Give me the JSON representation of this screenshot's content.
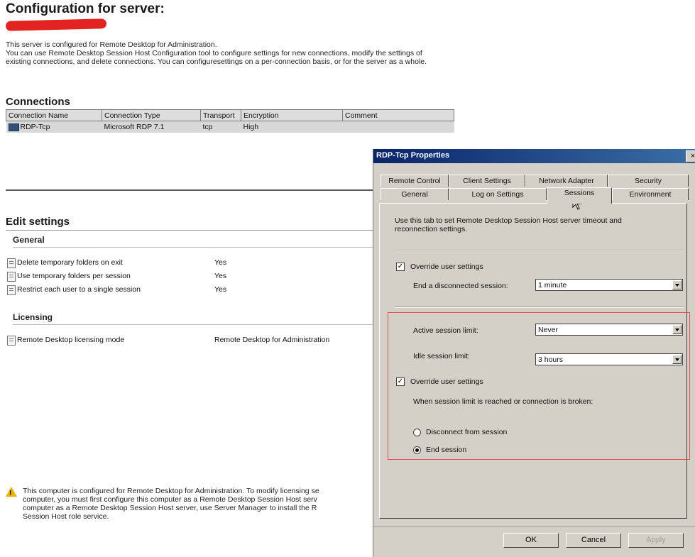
{
  "page": {
    "title": "Configuration for server:",
    "intro": [
      "This server is configured for Remote Desktop for Administration.",
      "You can use Remote Desktop Session Host Configuration tool to configure settings for new connections, modify the settings of",
      "existing connections, and delete connections. You can configuresettings on a per-connection basis, or for the server as a whole."
    ]
  },
  "connections": {
    "heading": "Connections",
    "columns": [
      "Connection Name",
      "Connection Type",
      "Transport",
      "Encryption",
      "Comment"
    ],
    "rows": [
      {
        "name": "RDP-Tcp",
        "type": "Microsoft RDP 7.1",
        "transport": "tcp",
        "encryption": "High",
        "comment": ""
      }
    ]
  },
  "edit_settings": {
    "heading": "Edit settings",
    "general": {
      "heading": "General",
      "items": [
        {
          "name": "Delete temporary folders on exit",
          "value": "Yes"
        },
        {
          "name": "Use temporary folders per session",
          "value": "Yes"
        },
        {
          "name": "Restrict each user to a single session",
          "value": "Yes"
        }
      ]
    },
    "licensing": {
      "heading": "Licensing",
      "items": [
        {
          "name": "Remote Desktop licensing mode",
          "value": "Remote Desktop for Administration"
        }
      ]
    }
  },
  "warning": {
    "lines": [
      "This computer is configured for Remote Desktop for Administration. To modify licensing se",
      "computer, you must first configure this computer as a Remote Desktop Session Host serv",
      "computer as a Remote Desktop Session Host server, use Server Manager to install the R",
      "Session Host role service."
    ]
  },
  "dialog": {
    "title": "RDP-Tcp Properties",
    "close_glyph": "×",
    "tabs_row1": [
      "Remote Control",
      "Client Settings",
      "Network Adapter",
      "Security"
    ],
    "tabs_row2": [
      "General",
      "Log on Settings",
      "Sessions",
      "Environment"
    ],
    "active_tab": "Sessions",
    "description": [
      "Use this tab to set Remote Desktop Session Host server timeout and",
      "reconnection settings."
    ],
    "override1": {
      "label": "Override user settings",
      "checked": true
    },
    "end_disconnected": {
      "label": "End a disconnected session:",
      "value": "1 minute"
    },
    "active_limit": {
      "label": "Active session limit:",
      "value": "Never"
    },
    "idle_limit": {
      "label": "Idle session limit:",
      "value": "3 hours"
    },
    "override2": {
      "label": "Override user settings",
      "checked": true
    },
    "limit_text": "When session limit is reached or connection is broken:",
    "radio_disconnect": {
      "label": "Disconnect from session",
      "selected": false
    },
    "radio_end": {
      "label": "End session",
      "selected": true
    },
    "buttons": {
      "ok": "OK",
      "cancel": "Cancel",
      "apply": "Apply"
    }
  },
  "colors": {
    "highlight_box": "#e05050",
    "redaction": "#e32222",
    "titlebar": "#0a246a"
  }
}
